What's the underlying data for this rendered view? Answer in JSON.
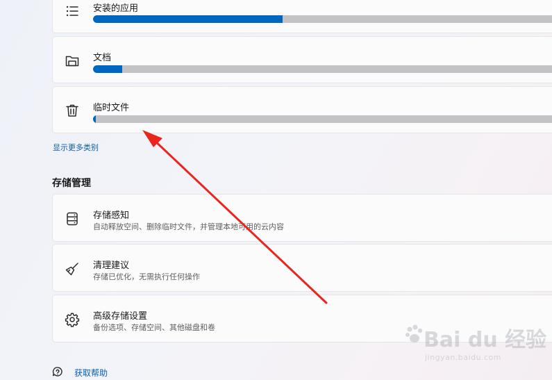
{
  "categories": [
    {
      "label": "安装的应用",
      "icon": "list-icon",
      "usage_fraction": 0.39
    },
    {
      "label": "文档",
      "icon": "folder-icon",
      "usage_fraction": 0.06
    },
    {
      "label": "临时文件",
      "icon": "trash-icon",
      "usage_fraction": 0.003
    }
  ],
  "show_more_link": "显示更多类别",
  "storage_management": {
    "title": "存储管理",
    "items": [
      {
        "title": "存储感知",
        "desc": "自动释放空间、删除临时文件，并管理本地可用的云内容",
        "icon": "storage-drive-icon"
      },
      {
        "title": "清理建议",
        "desc": "存储已优化，无需执行任何操作",
        "icon": "broom-icon"
      },
      {
        "title": "高级存储设置",
        "desc": "备份选项、存储空间、其他磁盘和卷",
        "icon": "gear-icon"
      }
    ]
  },
  "help_link": "获取帮助",
  "watermark": {
    "brand": "Bai du 经验",
    "url": "jingyan.baidu.com"
  },
  "colors": {
    "accent": "#0067c0",
    "bar_track": "#c3c3c5",
    "annotation_arrow": "#e8261e"
  }
}
